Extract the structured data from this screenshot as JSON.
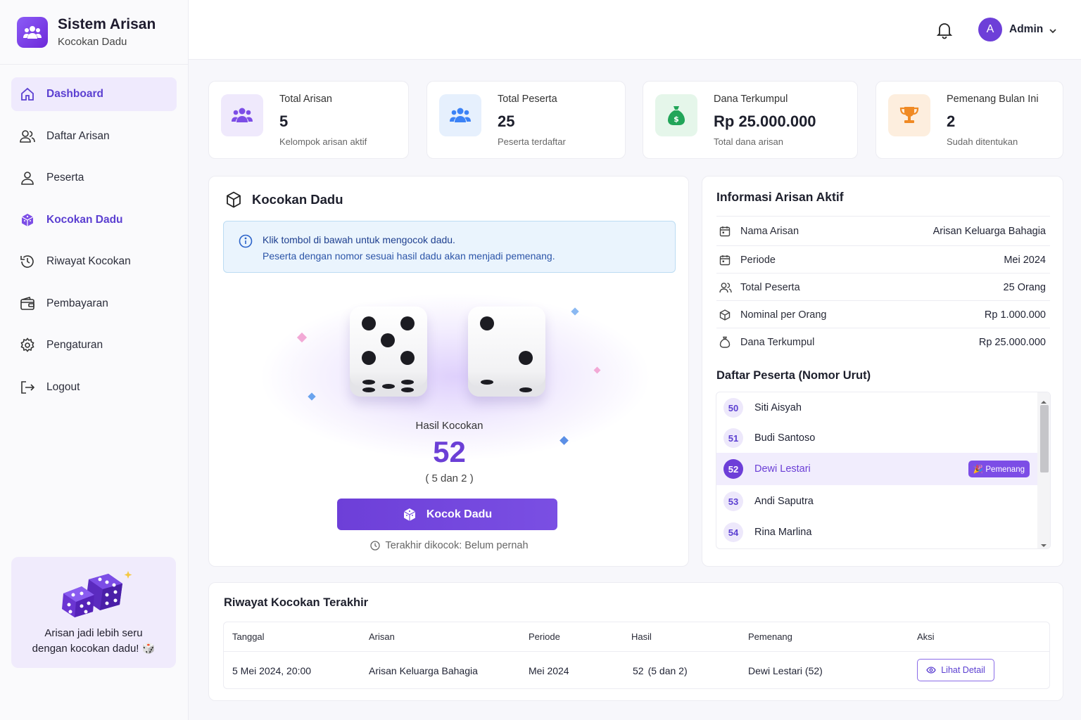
{
  "brand": {
    "title": "Sistem Arisan",
    "subtitle": "Kocokan Dadu"
  },
  "sidebar": {
    "items": [
      {
        "label": "Dashboard",
        "icon": "home-icon"
      },
      {
        "label": "Daftar Arisan",
        "icon": "users-icon"
      },
      {
        "label": "Peserta",
        "icon": "user-icon"
      },
      {
        "label": "Kocokan Dadu",
        "icon": "dice-cube-icon"
      },
      {
        "label": "Riwayat Kocokan",
        "icon": "history-icon"
      },
      {
        "label": "Pembayaran",
        "icon": "wallet-icon"
      },
      {
        "label": "Pengaturan",
        "icon": "gear-icon"
      },
      {
        "label": "Logout",
        "icon": "logout-icon"
      }
    ],
    "promo": {
      "line1": "Arisan jadi lebih seru",
      "line2": "dengan kocokan dadu! 🎲"
    }
  },
  "header": {
    "avatar_initial": "A",
    "user_name": "Admin"
  },
  "stats": [
    {
      "label": "Total Arisan",
      "value": "5",
      "sub": "Kelompok arisan aktif",
      "icon": "group-icon",
      "color": "#7c4de6"
    },
    {
      "label": "Total Peserta",
      "value": "25",
      "sub": "Peserta terdaftar",
      "icon": "group-icon",
      "color": "#3b82f6"
    },
    {
      "label": "Dana Terkumpul",
      "value": "Rp 25.000.000",
      "sub": "Total dana arisan",
      "icon": "money-bag-icon",
      "color": "#22a559"
    },
    {
      "label": "Pemenang Bulan Ini",
      "value": "2",
      "sub": "Sudah ditentukan",
      "icon": "trophy-icon",
      "color": "#f08a24"
    }
  ],
  "dice_panel": {
    "title": "Kocokan Dadu",
    "info_line1": "Klik tombol di bawah untuk mengocok dadu.",
    "info_line2": "Peserta dengan nomor sesuai hasil dadu akan menjadi pemenang.",
    "dice": [
      5,
      2
    ],
    "result_label": "Hasil Kocokan",
    "result_value": "52",
    "result_detail": "( 5 dan 2 )",
    "button_label": "Kocok Dadu",
    "last_roll": "Terakhir dikocok: Belum pernah"
  },
  "info_panel": {
    "title": "Informasi Arisan Aktif",
    "rows": [
      {
        "key": "Nama Arisan",
        "value": "Arisan Keluarga Bahagia",
        "icon": "calendar-icon"
      },
      {
        "key": "Periode",
        "value": "Mei 2024",
        "icon": "calendar-icon"
      },
      {
        "key": "Total Peserta",
        "value": "25 Orang",
        "icon": "users-icon"
      },
      {
        "key": "Nominal per Orang",
        "value": "Rp 1.000.000",
        "icon": "coin-icon"
      },
      {
        "key": "Dana Terkumpul",
        "value": "Rp 25.000.000",
        "icon": "money-bag-icon"
      }
    ],
    "list_title": "Daftar Peserta (Nomor Urut)",
    "participants": [
      {
        "num": "50",
        "name": "Siti Aisyah"
      },
      {
        "num": "51",
        "name": "Budi Santoso"
      },
      {
        "num": "52",
        "name": "Dewi Lestari"
      },
      {
        "num": "53",
        "name": "Andi Saputra"
      },
      {
        "num": "54",
        "name": "Rina Marlina"
      }
    ],
    "winner_badge": "🎉 Pemenang"
  },
  "history": {
    "title": "Riwayat Kocokan Terakhir",
    "columns": [
      "Tanggal",
      "Arisan",
      "Periode",
      "Hasil",
      "Pemenang",
      "Aksi"
    ],
    "rows": [
      {
        "tanggal": "5 Mei 2024, 20:00",
        "arisan": "Arisan Keluarga Bahagia",
        "periode": "Mei 2024",
        "hasil_num": "52",
        "hasil_detail": "(5 dan 2)",
        "pemenang": "Dewi Lestari (52)",
        "aksi": "Lihat Detail"
      }
    ]
  }
}
